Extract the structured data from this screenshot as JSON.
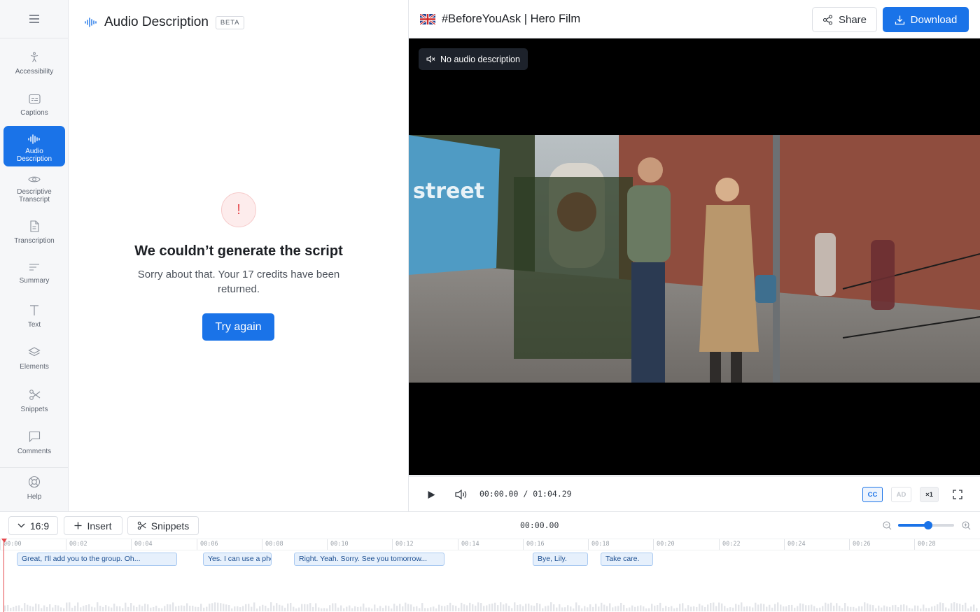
{
  "sidebar": {
    "items": [
      {
        "label": "Accessibility",
        "icon": "accessibility-icon"
      },
      {
        "label": "Captions",
        "icon": "captions-icon"
      },
      {
        "label": "Audio\nDescription",
        "icon": "audio-wave-icon",
        "active": true
      },
      {
        "label": "Descriptive\nTranscript",
        "icon": "eye-icon"
      },
      {
        "label": "Transcription",
        "icon": "document-icon"
      },
      {
        "label": "Summary",
        "icon": "lines-icon"
      },
      {
        "label": "Text",
        "icon": "text-icon"
      },
      {
        "label": "Elements",
        "icon": "layers-icon"
      },
      {
        "label": "Snippets",
        "icon": "scissors-icon"
      },
      {
        "label": "Comments",
        "icon": "comment-icon"
      }
    ],
    "help_label": "Help"
  },
  "panel": {
    "title": "Audio Description",
    "badge": "BETA",
    "error_icon": "!",
    "error_title": "We couldn’t generate the script",
    "error_message": "Sorry about that. Your 17 credits have been returned.",
    "retry_label": "Try again"
  },
  "header": {
    "project_title": "#BeforeYouAsk | Hero Film",
    "share_label": "Share",
    "download_label": "Download"
  },
  "video": {
    "ad_status": "No audio description",
    "current_time": "00:00.00",
    "separator": "/",
    "duration": "01:04.29",
    "cc_label": "CC",
    "ad_label": "AD",
    "speed_label": "×1"
  },
  "timeline": {
    "aspect_label": "16:9",
    "insert_label": "Insert",
    "snippets_label": "Snippets",
    "current_time": "00:00.00",
    "ruler_ticks": [
      "00:00",
      "00:02",
      "00:04",
      "00:06",
      "00:08",
      "00:10",
      "00:12",
      "00:14",
      "00:16",
      "00:18",
      "00:20",
      "00:22",
      "00:24",
      "00:26",
      "00:28"
    ],
    "clips": [
      {
        "text": "Great, I'll add you to the group. Oh..."
      },
      {
        "text": "Yes. I can use a phone"
      },
      {
        "text": "Right. Yeah. Sorry. See you tomorrow..."
      },
      {
        "text": "Bye, Lily."
      },
      {
        "text": "Take care."
      }
    ]
  },
  "colors": {
    "accent": "#1a73e8",
    "error": "#e5484d"
  }
}
